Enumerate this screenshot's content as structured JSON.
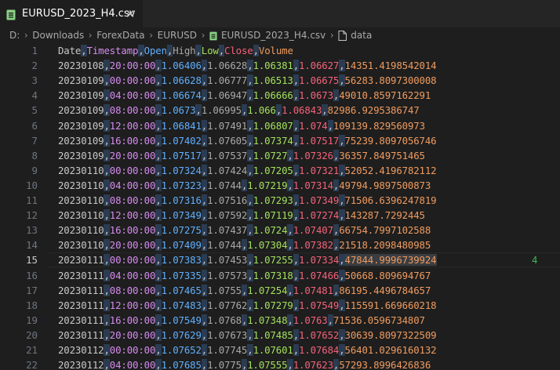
{
  "tab": {
    "label": "EURUSD_2023_H4.csv",
    "close_label": "✕"
  },
  "breadcrumb": [
    "D:",
    "Downloads",
    "ForexData",
    "EURUSD",
    "EURUSD_2023_H4.csv",
    "data"
  ],
  "colors": {
    "editor_bg": "#1e1e1e",
    "col_date": "#c8c8c8",
    "col_timestamp": "#d58cf0",
    "col_open": "#5fb0ff",
    "col_high": "#a9a9a9",
    "col_low": "#a3e05c",
    "col_close": "#f4627a",
    "col_volume": "#ef9b5f"
  },
  "icons": {
    "file": "csv-file-icon",
    "symbol": "file-outline-icon",
    "close": "close-icon"
  },
  "editor": {
    "current_line": 15,
    "current_line_suffix": "4",
    "lines": [
      {
        "n": "1",
        "cells": [
          "Date",
          "Timestamp",
          "Open",
          "High",
          "Low",
          "Close",
          "Volume"
        ]
      },
      {
        "n": "2",
        "cells": [
          "20230108",
          "20:00:00",
          "1.06406",
          "1.06628",
          "1.06381",
          "1.06627",
          "14351.4198542014"
        ]
      },
      {
        "n": "3",
        "cells": [
          "20230109",
          "00:00:00",
          "1.06628",
          "1.06777",
          "1.06513",
          "1.06675",
          "56283.8097300008"
        ]
      },
      {
        "n": "4",
        "cells": [
          "20230109",
          "04:00:00",
          "1.06674",
          "1.06947",
          "1.06666",
          "1.0673",
          "49010.8597162291"
        ]
      },
      {
        "n": "5",
        "cells": [
          "20230109",
          "08:00:00",
          "1.0673",
          "1.06995",
          "1.066",
          "1.06843",
          "82986.9295386747"
        ]
      },
      {
        "n": "6",
        "cells": [
          "20230109",
          "12:00:00",
          "1.06841",
          "1.07491",
          "1.06807",
          "1.074",
          "109139.829560973"
        ]
      },
      {
        "n": "7",
        "cells": [
          "20230109",
          "16:00:00",
          "1.07402",
          "1.07605",
          "1.07374",
          "1.07517",
          "75239.8097056746"
        ]
      },
      {
        "n": "8",
        "cells": [
          "20230109",
          "20:00:00",
          "1.07517",
          "1.07537",
          "1.0727",
          "1.07326",
          "36357.849751465"
        ]
      },
      {
        "n": "9",
        "cells": [
          "20230110",
          "00:00:00",
          "1.07324",
          "1.07424",
          "1.07205",
          "1.07321",
          "52052.4196782112"
        ]
      },
      {
        "n": "10",
        "cells": [
          "20230110",
          "04:00:00",
          "1.07323",
          "1.0744",
          "1.07219",
          "1.07314",
          "49794.9897500873"
        ]
      },
      {
        "n": "11",
        "cells": [
          "20230110",
          "08:00:00",
          "1.07316",
          "1.07516",
          "1.07293",
          "1.07349",
          "71506.6396247819"
        ]
      },
      {
        "n": "12",
        "cells": [
          "20230110",
          "12:00:00",
          "1.07349",
          "1.07592",
          "1.07119",
          "1.07274",
          "143287.7292445"
        ]
      },
      {
        "n": "13",
        "cells": [
          "20230110",
          "16:00:00",
          "1.07275",
          "1.07437",
          "1.0724",
          "1.07407",
          "66754.7997102588"
        ]
      },
      {
        "n": "14",
        "cells": [
          "20230110",
          "20:00:00",
          "1.07409",
          "1.0744",
          "1.07304",
          "1.07382",
          "21518.2098480985"
        ]
      },
      {
        "n": "15",
        "cells": [
          "20230111",
          "00:00:00",
          "1.07383",
          "1.07453",
          "1.07255",
          "1.07334",
          "47844.9996739924"
        ]
      },
      {
        "n": "16",
        "cells": [
          "20230111",
          "04:00:00",
          "1.07335",
          "1.07573",
          "1.07318",
          "1.07466",
          "50668.809694767"
        ]
      },
      {
        "n": "17",
        "cells": [
          "20230111",
          "08:00:00",
          "1.07465",
          "1.0755",
          "1.07254",
          "1.07481",
          "86195.4496784657"
        ]
      },
      {
        "n": "18",
        "cells": [
          "20230111",
          "12:00:00",
          "1.07483",
          "1.07762",
          "1.07279",
          "1.07549",
          "115591.669660218"
        ]
      },
      {
        "n": "19",
        "cells": [
          "20230111",
          "16:00:00",
          "1.07549",
          "1.0768",
          "1.07348",
          "1.0763",
          "71536.0596734807"
        ]
      },
      {
        "n": "20",
        "cells": [
          "20230111",
          "20:00:00",
          "1.07629",
          "1.07673",
          "1.07485",
          "1.07652",
          "30639.8097322509"
        ]
      },
      {
        "n": "21",
        "cells": [
          "20230112",
          "00:00:00",
          "1.07652",
          "1.07745",
          "1.07601",
          "1.07684",
          "56401.0296160132"
        ]
      },
      {
        "n": "22",
        "cells": [
          "20230112",
          "04:00:00",
          "1.07685",
          "1.0775",
          "1.07555",
          "1.07623",
          "57293.8996426836"
        ]
      }
    ]
  }
}
